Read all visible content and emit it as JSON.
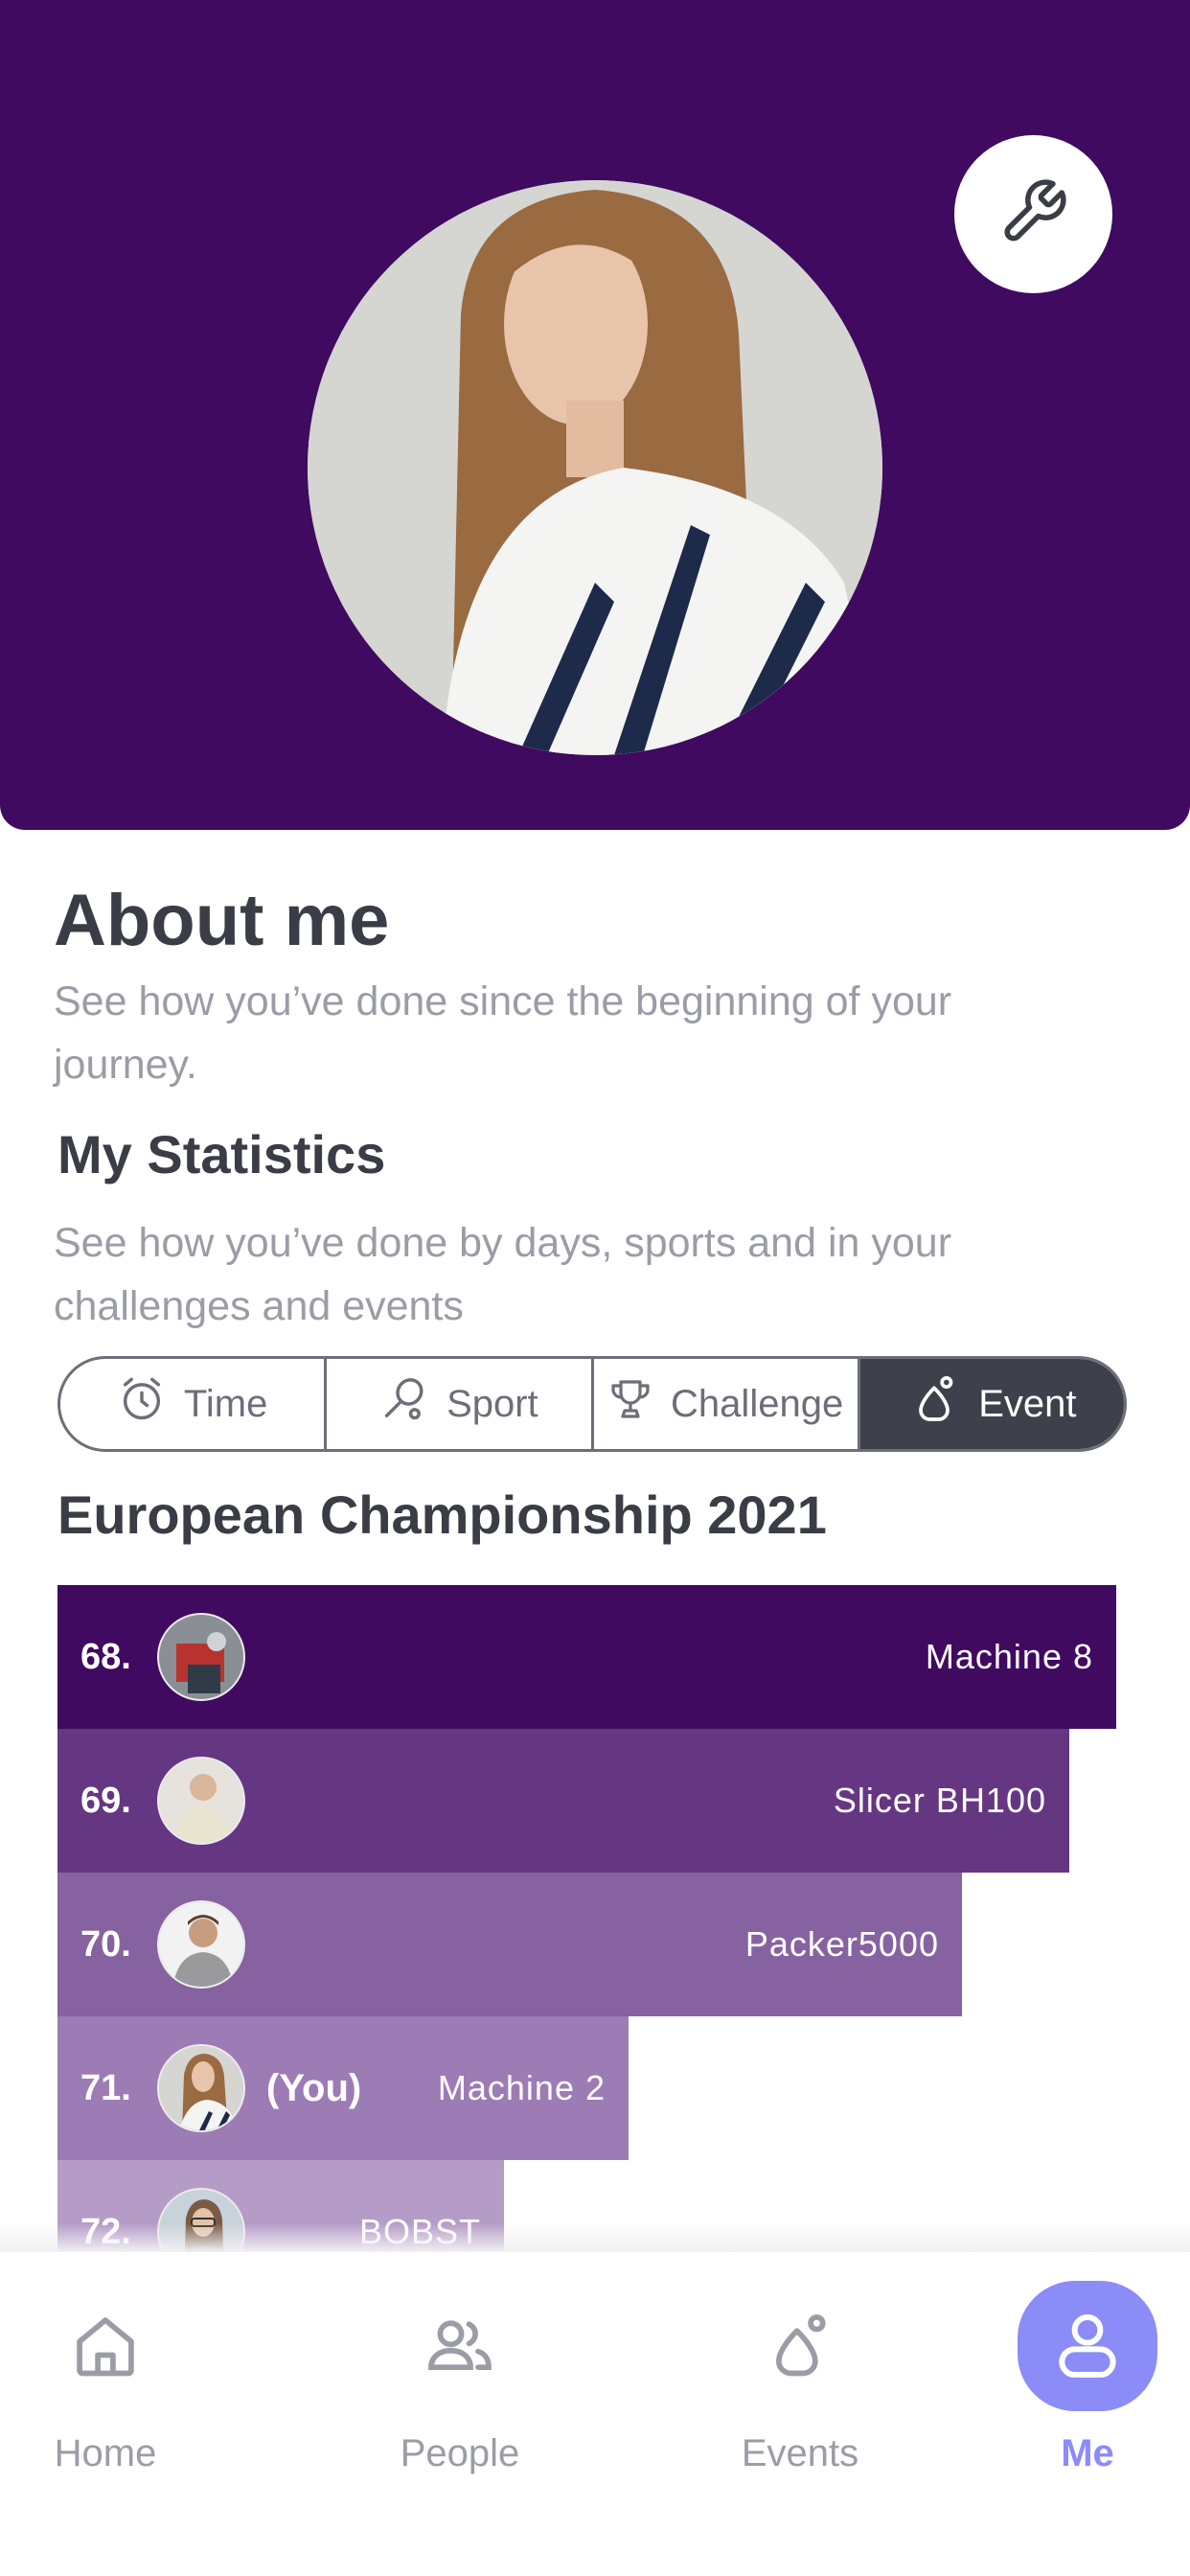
{
  "profile": {
    "settings_icon": "wrench-icon"
  },
  "about": {
    "title": "About me",
    "subtitle": "See how you’ve done since the beginning of your journey."
  },
  "statistics": {
    "title": "My Statistics",
    "subtitle": "See how you’ve done by days, sports and in your challenges and events",
    "tabs": [
      {
        "label": "Time",
        "icon": "alarm-clock-icon",
        "active": false
      },
      {
        "label": "Sport",
        "icon": "racket-icon",
        "active": false
      },
      {
        "label": "Challenge",
        "icon": "trophy-icon",
        "active": false
      },
      {
        "label": "Event",
        "icon": "event-drop-icon",
        "active": true
      }
    ]
  },
  "leaderboard": {
    "event_title": "European Championship 2021",
    "rows": [
      {
        "rank": "68.",
        "name": "Machine 8",
        "you": "",
        "fill": 0.89,
        "color": "#400a60"
      },
      {
        "rank": "69.",
        "name": "Slicer BH100",
        "you": "",
        "fill": 0.85,
        "color": "#653783"
      },
      {
        "rank": "70.",
        "name": "Packer5000",
        "you": "",
        "fill": 0.76,
        "color": "#8762a0"
      },
      {
        "rank": "71.",
        "name": "Machine 2",
        "you": "(You)",
        "fill": 0.48,
        "color": "#9d7bb4"
      },
      {
        "rank": "72.",
        "name": "BOBST",
        "you": "",
        "fill": 0.375,
        "color": "#b59cc7"
      }
    ]
  },
  "nav": {
    "items": [
      {
        "label": "Home",
        "icon": "home-icon",
        "active": false
      },
      {
        "label": "People",
        "icon": "people-icon",
        "active": false
      },
      {
        "label": "Events",
        "icon": "events-icon",
        "active": false
      },
      {
        "label": "Me",
        "icon": "user-icon",
        "active": true
      }
    ]
  },
  "colors": {
    "brand_purple": "#400a60",
    "active_nav": "#8b8cf8",
    "segment_active": "#3e414b"
  }
}
